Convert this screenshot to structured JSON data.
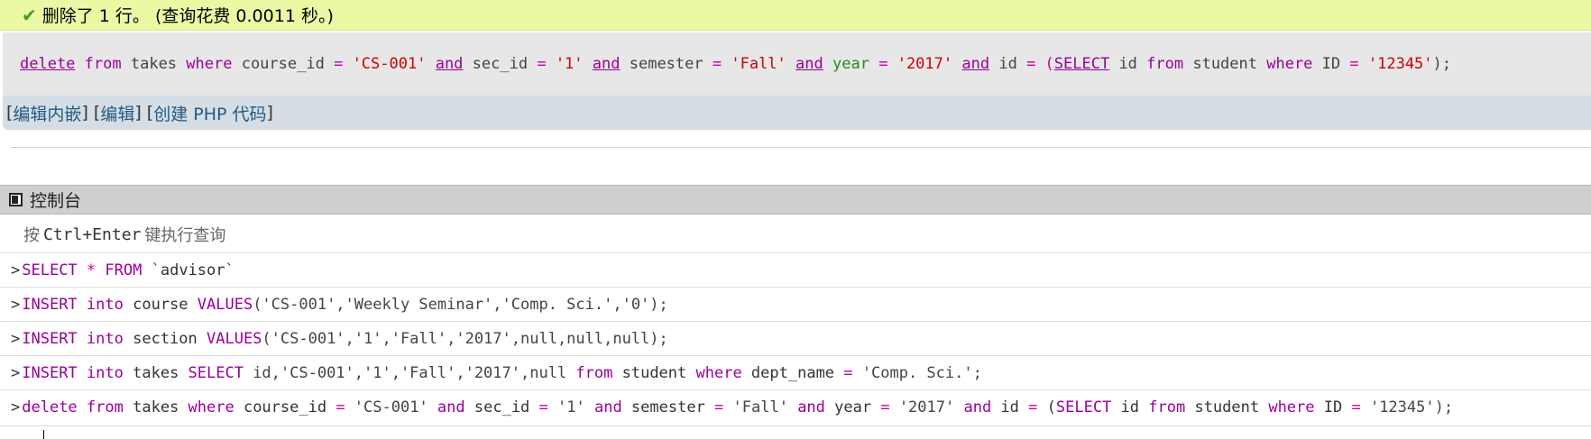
{
  "success": {
    "icon": "checkmark-icon",
    "message": "删除了 1 行。 (查询花费 0.0011 秒。)"
  },
  "sql": {
    "t1": "delete",
    "t2": " ",
    "t3": "from",
    "t4": " takes ",
    "t5": "where",
    "t6": " course_id ",
    "t7": "=",
    "t8": " ",
    "t9": "'CS-001'",
    "t10": " ",
    "t11": "and",
    "t12": " sec_id ",
    "t13": "=",
    "t14": " ",
    "t15": "'1'",
    "t16": " ",
    "t17": "and",
    "t18": " semester ",
    "t19": "=",
    "t20": " ",
    "t21": "'Fall'",
    "t22": " ",
    "t23": "and",
    "t24": " ",
    "t25": "year",
    "t26": " ",
    "t27": "=",
    "t28": " ",
    "t29": "'2017'",
    "t30": " ",
    "t31": "and",
    "t32": " id ",
    "t33": "=",
    "t34": " (",
    "t35": "SELECT",
    "t36": " id ",
    "t37": "from",
    "t38": " student ",
    "t39": "where",
    "t40": " ID ",
    "t41": "=",
    "t42": " ",
    "t43": "'12345'",
    "t44": ");"
  },
  "actions": {
    "open1": "[ ",
    "edit_inline": "编辑内嵌",
    "sep1": " ] [ ",
    "edit": "编辑",
    "sep2": " ] [ ",
    "create_php": "创建 PHP 代码",
    "close": " ]"
  },
  "console": {
    "title": "控制台",
    "icon": "console-icon",
    "hint_pre": "按",
    "hint_key": "Ctrl+Enter",
    "hint_post": "键执行查询",
    "prompt": ">",
    "queries": [
      {
        "a": "SELECT",
        "b": " ",
        "c": "*",
        "d": " ",
        "e": "FROM",
        "f": " `advisor`"
      },
      {
        "a": "INSERT",
        "b": " ",
        "c": "into",
        "d": " course ",
        "e": "VALUES",
        "f": "('CS-001','Weekly Seminar','Comp. Sci.','0');"
      },
      {
        "a": "INSERT",
        "b": " ",
        "c": "into",
        "d": " section ",
        "e": "VALUES",
        "f": "('CS-001','1','Fall','2017',null,null,null);"
      },
      {
        "a": "INSERT",
        "b": " ",
        "c": "into",
        "d": " takes ",
        "e": "SELECT",
        "f": " id,'CS-001','1','Fall','2017',null ",
        "g": "from",
        "h": " student ",
        "i": "where",
        "j": " dept_name ",
        "k": "=",
        "l": " 'Comp. Sci.';"
      },
      {
        "a": "delete",
        "b": " ",
        "c": "from",
        "d": " takes ",
        "e": "where",
        "f": " course_id ",
        "g": "=",
        "h": " 'CS-001' ",
        "i": "and",
        "j": " sec_id ",
        "k": "=",
        "l": " '1' ",
        "m": "and",
        "n": " semester ",
        "o": "=",
        "p": " 'Fall' ",
        "q": "and",
        "r": " year ",
        "s": "=",
        "t": " '2017' ",
        "u": "and",
        "v": " id ",
        "w": "=",
        "x": " (",
        "y": "SELECT",
        "z": " id ",
        "aa": "from",
        "ab": " student ",
        "ac": "where",
        "ad": " ID ",
        "ae": "=",
        "af": " '12345');"
      }
    ]
  }
}
